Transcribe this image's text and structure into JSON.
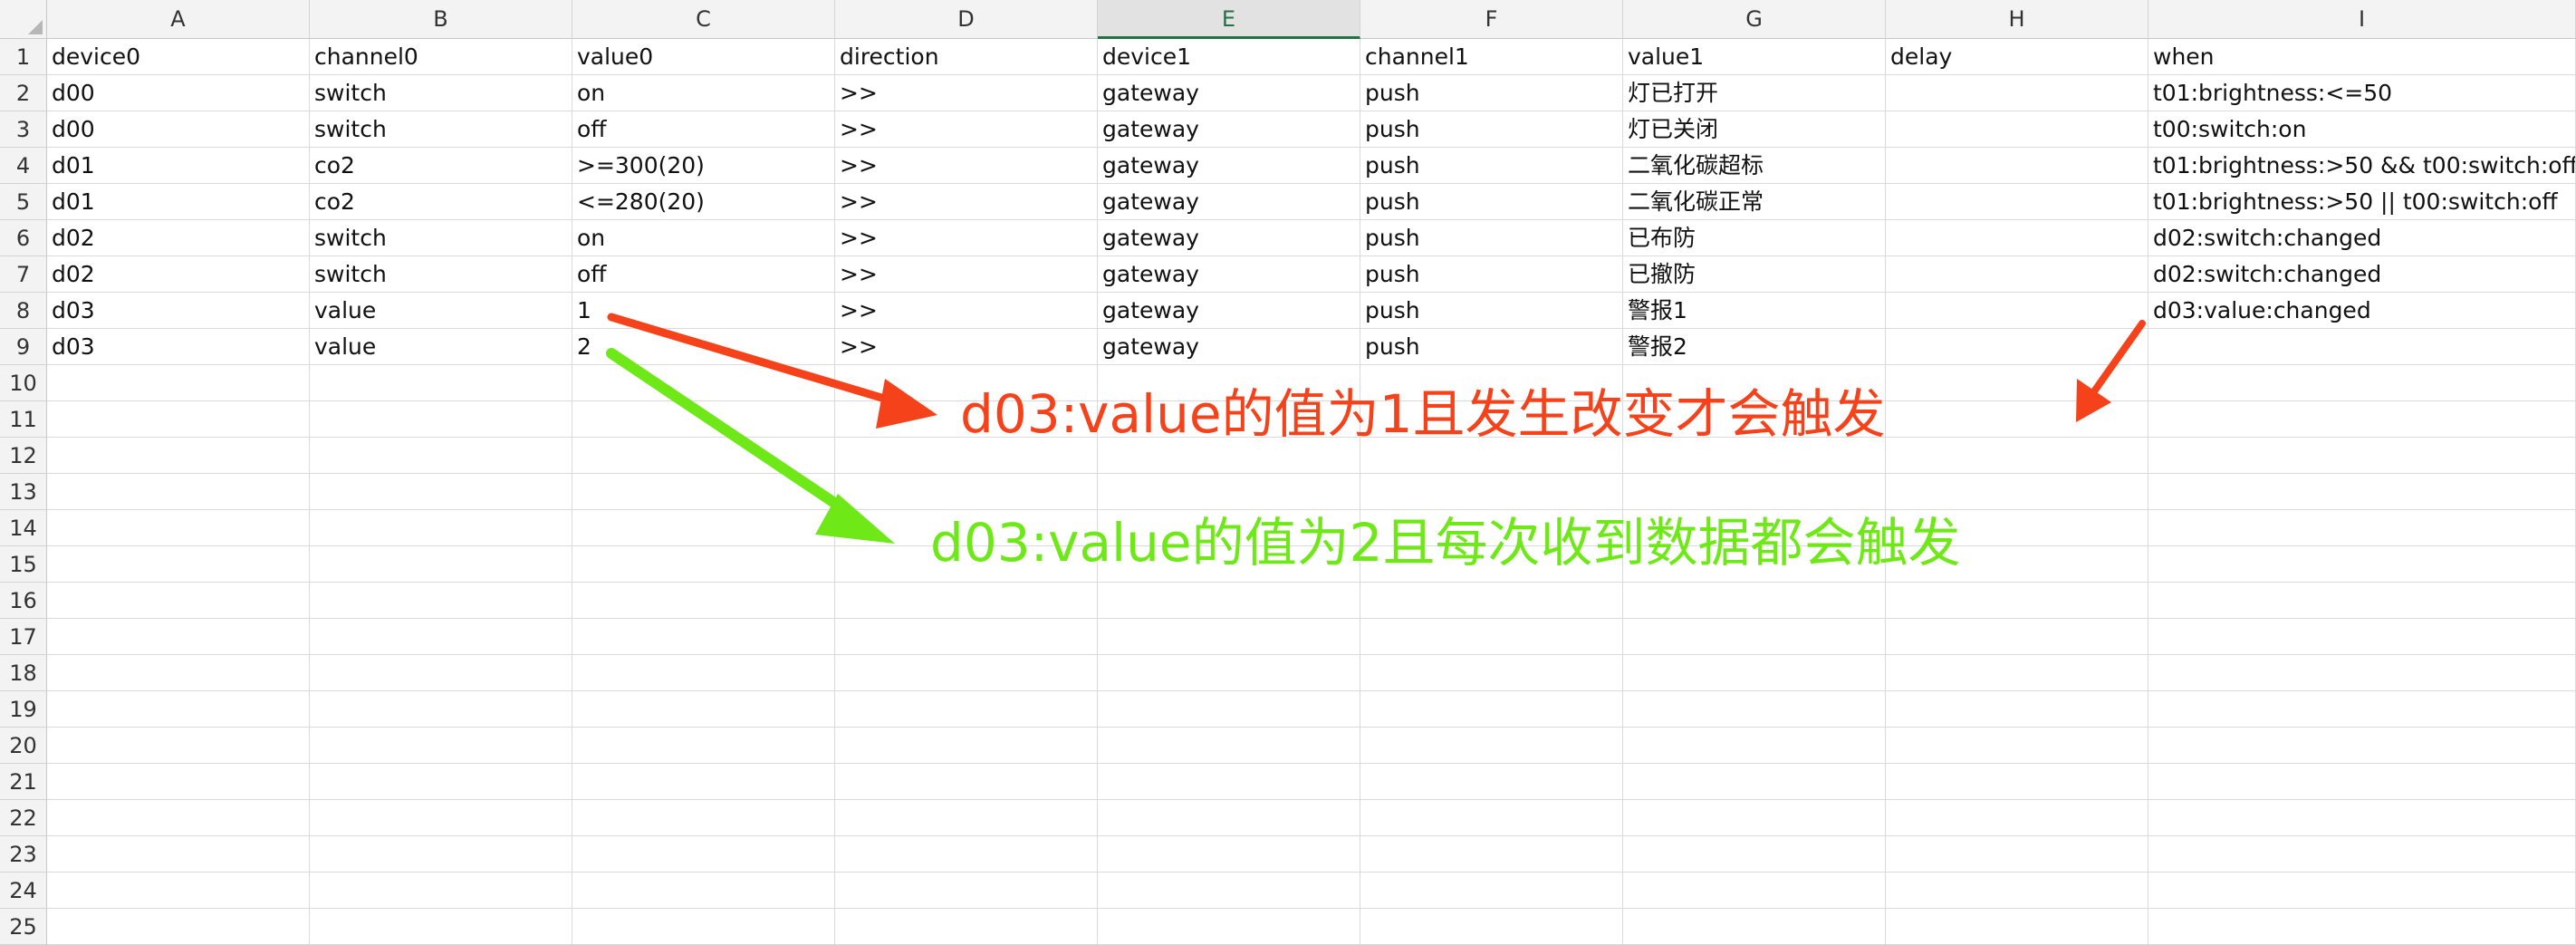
{
  "columns": [
    "A",
    "B",
    "C",
    "D",
    "E",
    "F",
    "G",
    "H",
    "I"
  ],
  "selected_column": "E",
  "row_numbers": [
    "1",
    "2",
    "3",
    "4",
    "5",
    "6",
    "7",
    "8",
    "9",
    "10",
    "11",
    "12",
    "13",
    "14",
    "15",
    "16",
    "17",
    "18",
    "19",
    "20",
    "21",
    "22",
    "23",
    "24",
    "25"
  ],
  "rows": [
    [
      "device0",
      "channel0",
      "value0",
      "direction",
      "device1",
      "channel1",
      "value1",
      "delay",
      "when"
    ],
    [
      "d00",
      "switch",
      "on",
      ">>",
      "gateway",
      "push",
      "灯已打开",
      "",
      "t01:brightness:<=50"
    ],
    [
      "d00",
      "switch",
      "off",
      ">>",
      "gateway",
      "push",
      "灯已关闭",
      "",
      "t00:switch:on"
    ],
    [
      "d01",
      "co2",
      ">=300(20)",
      ">>",
      "gateway",
      "push",
      "二氧化碳超标",
      "",
      "t01:brightness:>50 && t00:switch:off"
    ],
    [
      "d01",
      "co2",
      "<=280(20)",
      ">>",
      "gateway",
      "push",
      "二氧化碳正常",
      "",
      "t01:brightness:>50 || t00:switch:off"
    ],
    [
      "d02",
      "switch",
      "on",
      ">>",
      "gateway",
      "push",
      "已布防",
      "",
      "d02:switch:changed"
    ],
    [
      "d02",
      "switch",
      "off",
      ">>",
      "gateway",
      "push",
      "已撤防",
      "",
      "d02:switch:changed"
    ],
    [
      "d03",
      "value",
      "1",
      ">>",
      "gateway",
      "push",
      "警报1",
      "",
      "d03:value:changed"
    ],
    [
      "d03",
      "value",
      "2",
      ">>",
      "gateway",
      "push",
      "警报2",
      "",
      ""
    ]
  ],
  "annotations": {
    "red": {
      "text": "d03:value的值为1且发生改变才会触发",
      "color": "#f5421a"
    },
    "green": {
      "text": "d03:value的值为2且每次收到数据都会触发",
      "color": "#6ee817"
    }
  }
}
